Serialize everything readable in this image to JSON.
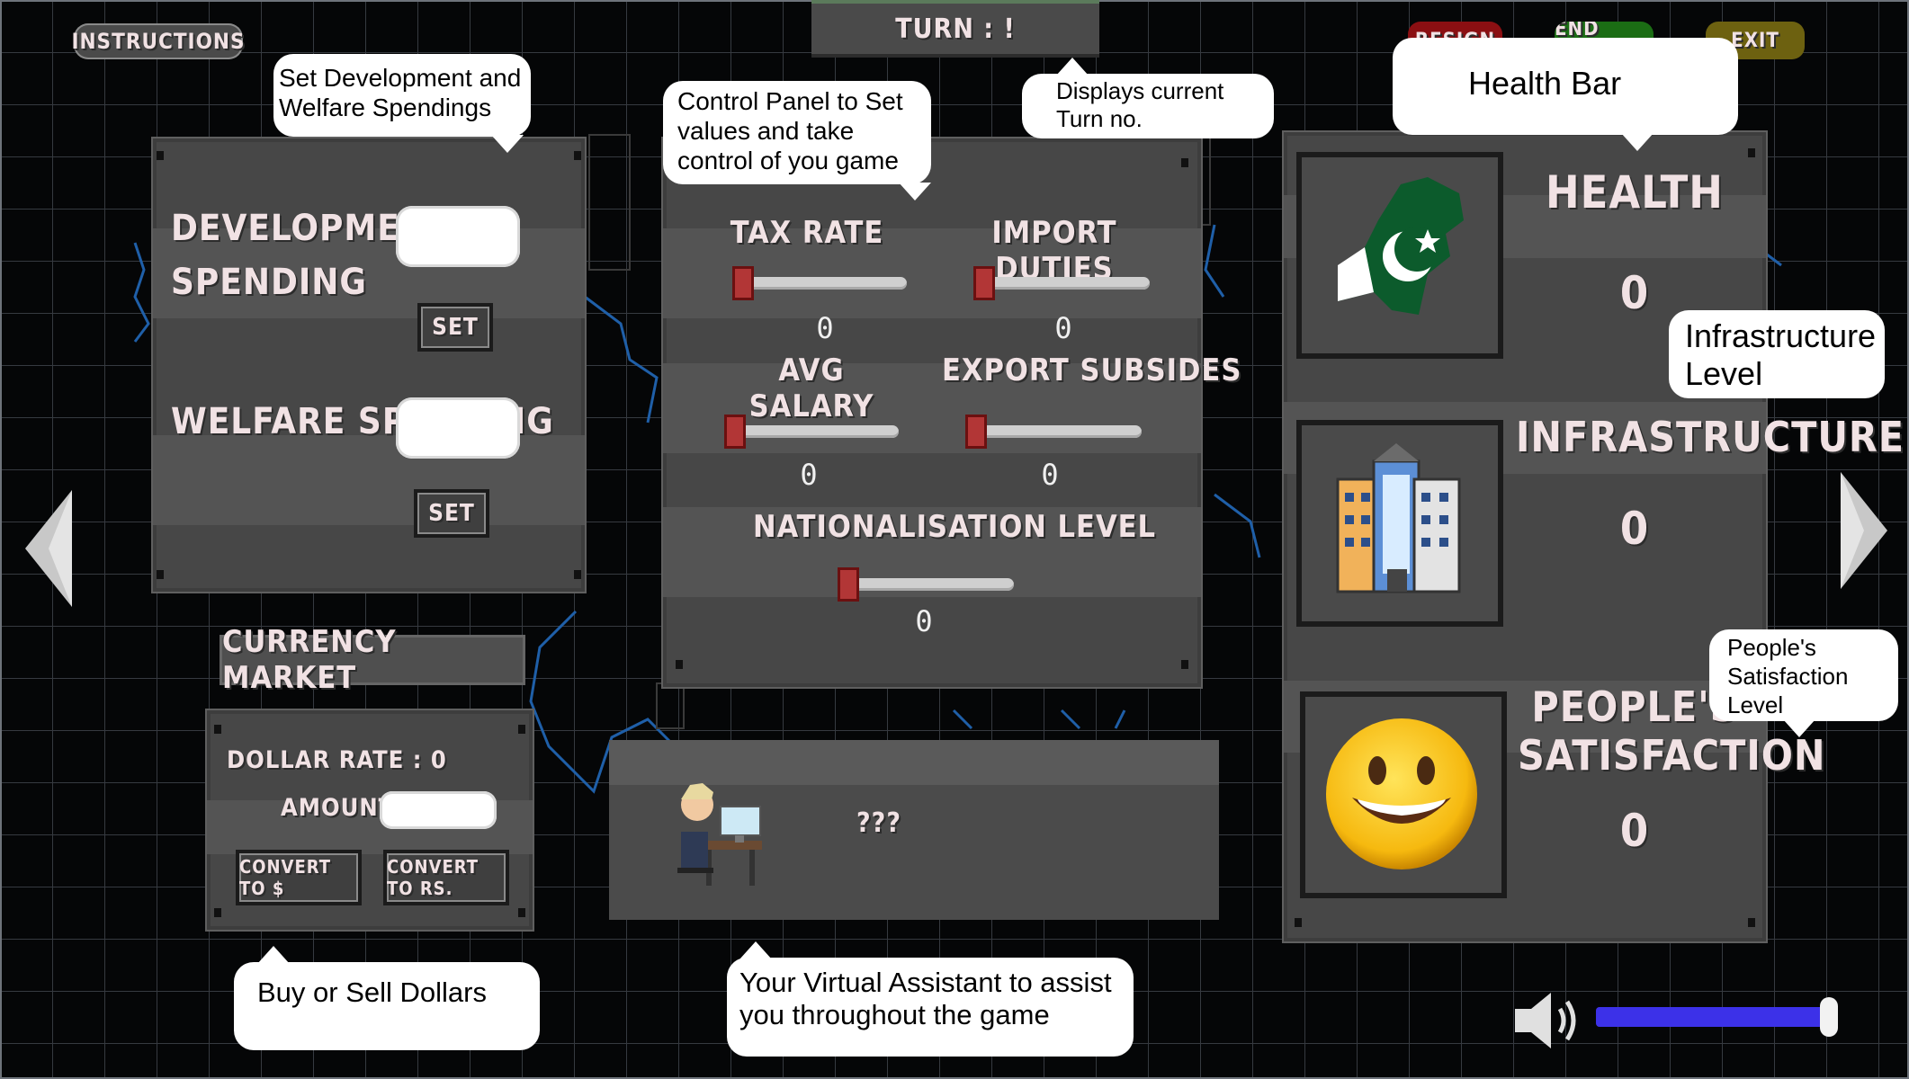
{
  "top": {
    "instructions_label": "INSTRUCTIONS",
    "turn_label": "TURN : !",
    "resign_label": "RESIGN",
    "end_turn_label": "END TURN",
    "exit_label": "EXIT"
  },
  "spending": {
    "development_label_1": "DEVELOPMENT",
    "development_label_2": "SPENDING",
    "welfare_label": "WELFARE SPENDING",
    "set_label": "SET"
  },
  "controls": {
    "tax_rate": {
      "label": "TAX RATE",
      "value": "0"
    },
    "import_duties": {
      "label": "IMPORT DUTIES",
      "value": "0"
    },
    "avg_salary": {
      "label": "AVG SALARY",
      "value": "0"
    },
    "export_subsidies": {
      "label": "EXPORT SUBSIDES",
      "value": "0"
    },
    "nationalisation": {
      "label": "NATIONALISATION LEVEL",
      "value": "0"
    }
  },
  "currency": {
    "title": "CURRENCY MARKET",
    "dollar_rate": "DOLLAR RATE : 0",
    "amount_label": "AMOUNT :",
    "convert_usd": "CONVERT TO $",
    "convert_rs": "CONVERT TO RS."
  },
  "assistant": {
    "text": "???"
  },
  "stats": {
    "health": {
      "label": "HEALTH",
      "value": "0"
    },
    "infrastructure": {
      "label": "INFRASTRUCTURE",
      "value": "0"
    },
    "satisfaction": {
      "label_1": "PEOPLE'S",
      "label_2": "SATISFACTION",
      "value": "0"
    }
  },
  "callouts": {
    "spending": "Set Development and Welfare Spendings",
    "control_panel": "Control Panel to Set values and take control of you game",
    "turn": "Displays current Turn no.",
    "health": "Health Bar",
    "infrastructure": "Infrastructure Level",
    "satisfaction": "People's Satisfaction Level",
    "currency": "Buy or Sell Dollars",
    "assistant": "Your Virtual Assistant to assist you throughout the game"
  },
  "volume": {
    "level": 0.98
  },
  "colors": {
    "resign": "#8b0f12",
    "end_turn": "#1b6d14",
    "exit": "#6d6110",
    "slider_knob": "#b23636",
    "volume_bar": "#3c31e8"
  }
}
